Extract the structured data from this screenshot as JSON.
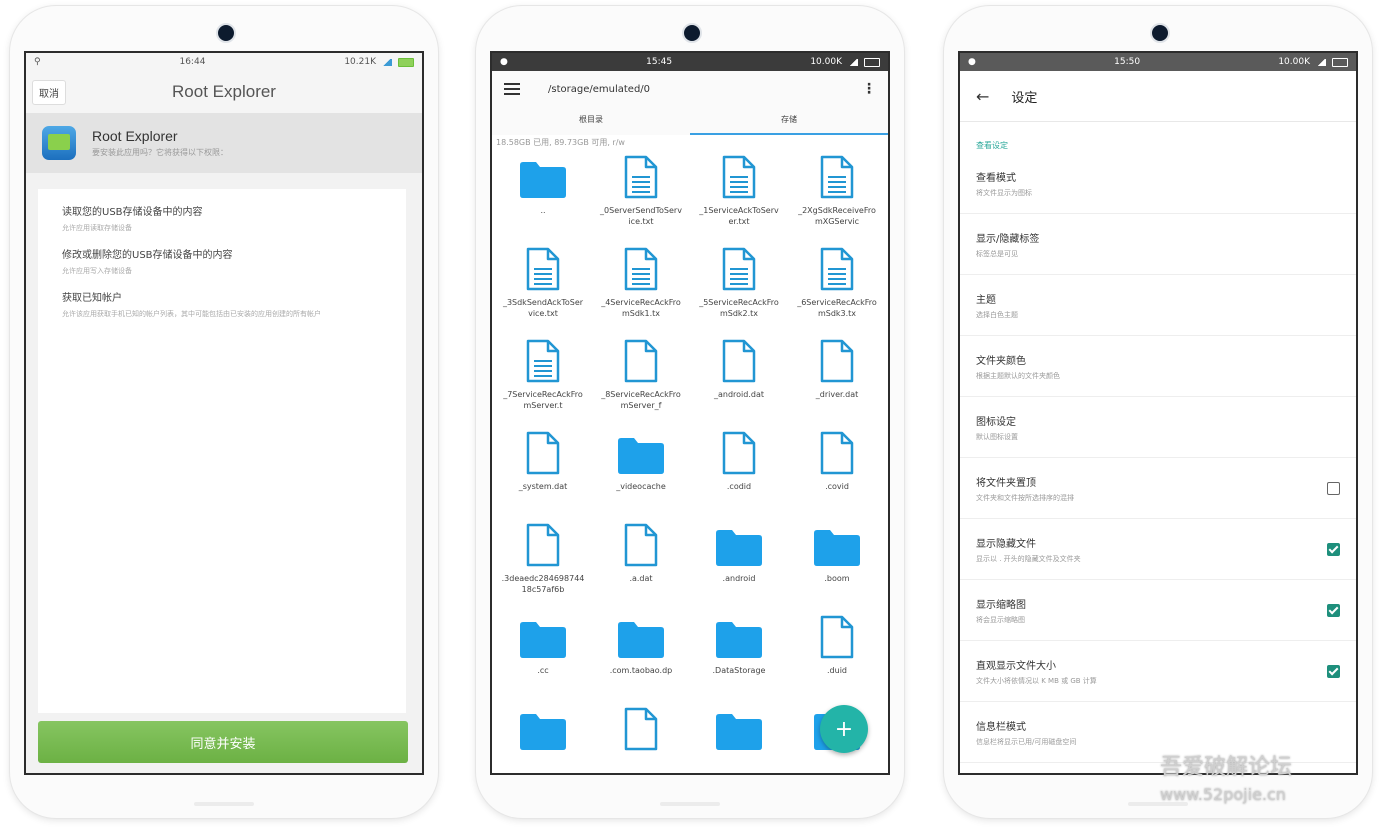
{
  "phone1": {
    "status": {
      "time": "16:44",
      "indicators": "10.21K"
    },
    "cancel_label": "取消",
    "title": "Root Explorer",
    "app": {
      "name": "Root Explorer",
      "subtitle": "要安装此应用吗？它将获得以下权限："
    },
    "permissions": [
      {
        "title": "读取您的USB存储设备中的内容",
        "desc": "允许应用读取存储设备"
      },
      {
        "title": "修改或删除您的USB存储设备中的内容",
        "desc": "允许应用写入存储设备"
      },
      {
        "title": "获取已知帐户",
        "desc": "允许该应用获取手机已知的帐户列表，其中可能包括由已安装的应用创建的所有帐户"
      }
    ],
    "install_label": "同意并安装"
  },
  "phone2": {
    "status": {
      "time": "15:45",
      "indicators": "10.00K"
    },
    "path": "/storage/emulated/0",
    "tabs": [
      {
        "label": "根目录"
      },
      {
        "label": "存储"
      }
    ],
    "storage_info": "18.58GB 已用, 89.73GB 可用, r/w",
    "files": [
      {
        "name": "..",
        "type": "folder"
      },
      {
        "name": "_0ServerSendToService.txt",
        "type": "text"
      },
      {
        "name": "_1ServiceAckToServer.txt",
        "type": "text"
      },
      {
        "name": "_2XgSdkReceiveFromXGServic",
        "type": "text"
      },
      {
        "name": "_3SdkSendAckToService.txt",
        "type": "text"
      },
      {
        "name": "_4ServiceRecAckFromSdk1.tx",
        "type": "text"
      },
      {
        "name": "_5ServiceRecAckFromSdk2.tx",
        "type": "text"
      },
      {
        "name": "_6ServiceRecAckFromSdk3.tx",
        "type": "text"
      },
      {
        "name": "_7ServiceRecAckFromServer.t",
        "type": "text"
      },
      {
        "name": "_8ServiceRecAckFromServer_f",
        "type": "file"
      },
      {
        "name": "_android.dat",
        "type": "file"
      },
      {
        "name": "_driver.dat",
        "type": "file"
      },
      {
        "name": "_system.dat",
        "type": "file"
      },
      {
        "name": "_videocache",
        "type": "folder"
      },
      {
        "name": ".codid",
        "type": "file"
      },
      {
        "name": ".covid",
        "type": "file"
      },
      {
        "name": ".3deaedc28469874418c57af6b",
        "type": "file"
      },
      {
        "name": ".a.dat",
        "type": "file"
      },
      {
        "name": ".android",
        "type": "folder"
      },
      {
        "name": ".boom",
        "type": "folder"
      },
      {
        "name": ".cc",
        "type": "folder"
      },
      {
        "name": ".com.taobao.dp",
        "type": "folder"
      },
      {
        "name": ".DataStorage",
        "type": "folder"
      },
      {
        "name": ".duid",
        "type": "file"
      },
      {
        "name": "",
        "type": "folder"
      },
      {
        "name": "",
        "type": "file"
      },
      {
        "name": "",
        "type": "folder"
      },
      {
        "name": "",
        "type": "folder"
      }
    ],
    "fab_label": "+",
    "colors": {
      "folder": "#1ea1ea",
      "file": "#2196d3",
      "fab": "#23b4a8",
      "tab_indicator": "#3aa0e3"
    }
  },
  "phone3": {
    "status": {
      "time": "15:50",
      "indicators": "10.00K"
    },
    "title": "设定",
    "section": "查看设定",
    "settings": [
      {
        "title": "查看模式",
        "subtitle": "将文件显示为图标",
        "checkbox": null
      },
      {
        "title": "显示/隐藏标签",
        "subtitle": "标签总是可见",
        "checkbox": null
      },
      {
        "title": "主题",
        "subtitle": "选择白色主题",
        "checkbox": null
      },
      {
        "title": "文件夹颜色",
        "subtitle": "根据主题默认的文件夹颜色",
        "checkbox": null
      },
      {
        "title": "图标设定",
        "subtitle": "默认图标设置",
        "checkbox": null
      },
      {
        "title": "将文件夹置顶",
        "subtitle": "文件夹和文件按所选排序的混排",
        "checkbox": false
      },
      {
        "title": "显示隐藏文件",
        "subtitle": "显示以 . 开头的隐藏文件及文件夹",
        "checkbox": true
      },
      {
        "title": "显示缩略图",
        "subtitle": "将会显示缩略图",
        "checkbox": true
      },
      {
        "title": "直观显示文件大小",
        "subtitle": "文件大小将依情况以 K MB 或 GB 计算",
        "checkbox": true
      },
      {
        "title": "信息栏模式",
        "subtitle": "信息栏将显示已用/可用磁盘空间",
        "checkbox": null
      }
    ],
    "colors": {
      "accent": "#1e8f7c",
      "section": "#2aa89a"
    }
  },
  "watermark": {
    "line1": "吾爱破解论坛",
    "line2": "www.52pojie.cn"
  }
}
